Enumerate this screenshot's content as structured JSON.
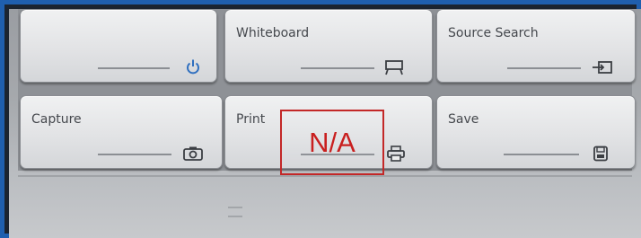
{
  "colors": {
    "frame": "#1f5fae",
    "power_icon": "#2f6fbf",
    "annotation": "#c91f1f"
  },
  "buttons": [
    {
      "id": "power",
      "label": "",
      "icon": "power-icon"
    },
    {
      "id": "whiteboard",
      "label": "Whiteboard",
      "icon": "whiteboard-icon"
    },
    {
      "id": "source-search",
      "label": "Source Search",
      "icon": "source-search-icon"
    },
    {
      "id": "capture",
      "label": "Capture",
      "icon": "camera-icon"
    },
    {
      "id": "print",
      "label": "Print",
      "icon": "printer-icon"
    },
    {
      "id": "save",
      "label": "Save",
      "icon": "save-icon"
    }
  ],
  "annotation": {
    "text": "N/A"
  }
}
